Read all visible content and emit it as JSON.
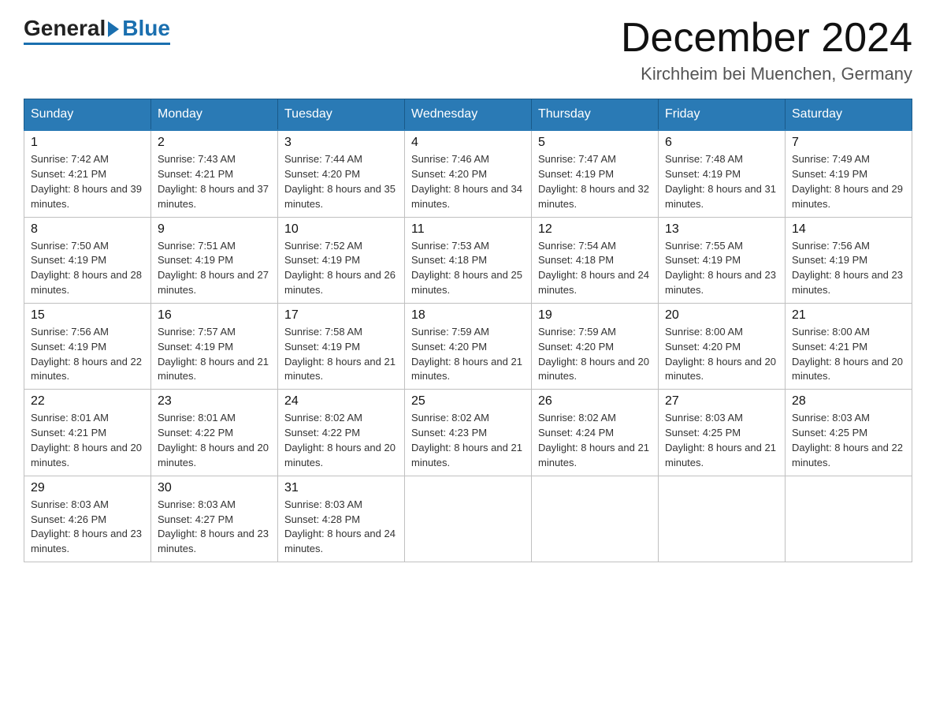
{
  "logo": {
    "general": "General",
    "blue": "Blue"
  },
  "header": {
    "month": "December 2024",
    "location": "Kirchheim bei Muenchen, Germany"
  },
  "days_of_week": [
    "Sunday",
    "Monday",
    "Tuesday",
    "Wednesday",
    "Thursday",
    "Friday",
    "Saturday"
  ],
  "weeks": [
    [
      {
        "day": "1",
        "sunrise": "7:42 AM",
        "sunset": "4:21 PM",
        "daylight": "8 hours and 39 minutes."
      },
      {
        "day": "2",
        "sunrise": "7:43 AM",
        "sunset": "4:21 PM",
        "daylight": "8 hours and 37 minutes."
      },
      {
        "day": "3",
        "sunrise": "7:44 AM",
        "sunset": "4:20 PM",
        "daylight": "8 hours and 35 minutes."
      },
      {
        "day": "4",
        "sunrise": "7:46 AM",
        "sunset": "4:20 PM",
        "daylight": "8 hours and 34 minutes."
      },
      {
        "day": "5",
        "sunrise": "7:47 AM",
        "sunset": "4:19 PM",
        "daylight": "8 hours and 32 minutes."
      },
      {
        "day": "6",
        "sunrise": "7:48 AM",
        "sunset": "4:19 PM",
        "daylight": "8 hours and 31 minutes."
      },
      {
        "day": "7",
        "sunrise": "7:49 AM",
        "sunset": "4:19 PM",
        "daylight": "8 hours and 29 minutes."
      }
    ],
    [
      {
        "day": "8",
        "sunrise": "7:50 AM",
        "sunset": "4:19 PM",
        "daylight": "8 hours and 28 minutes."
      },
      {
        "day": "9",
        "sunrise": "7:51 AM",
        "sunset": "4:19 PM",
        "daylight": "8 hours and 27 minutes."
      },
      {
        "day": "10",
        "sunrise": "7:52 AM",
        "sunset": "4:19 PM",
        "daylight": "8 hours and 26 minutes."
      },
      {
        "day": "11",
        "sunrise": "7:53 AM",
        "sunset": "4:18 PM",
        "daylight": "8 hours and 25 minutes."
      },
      {
        "day": "12",
        "sunrise": "7:54 AM",
        "sunset": "4:18 PM",
        "daylight": "8 hours and 24 minutes."
      },
      {
        "day": "13",
        "sunrise": "7:55 AM",
        "sunset": "4:19 PM",
        "daylight": "8 hours and 23 minutes."
      },
      {
        "day": "14",
        "sunrise": "7:56 AM",
        "sunset": "4:19 PM",
        "daylight": "8 hours and 23 minutes."
      }
    ],
    [
      {
        "day": "15",
        "sunrise": "7:56 AM",
        "sunset": "4:19 PM",
        "daylight": "8 hours and 22 minutes."
      },
      {
        "day": "16",
        "sunrise": "7:57 AM",
        "sunset": "4:19 PM",
        "daylight": "8 hours and 21 minutes."
      },
      {
        "day": "17",
        "sunrise": "7:58 AM",
        "sunset": "4:19 PM",
        "daylight": "8 hours and 21 minutes."
      },
      {
        "day": "18",
        "sunrise": "7:59 AM",
        "sunset": "4:20 PM",
        "daylight": "8 hours and 21 minutes."
      },
      {
        "day": "19",
        "sunrise": "7:59 AM",
        "sunset": "4:20 PM",
        "daylight": "8 hours and 20 minutes."
      },
      {
        "day": "20",
        "sunrise": "8:00 AM",
        "sunset": "4:20 PM",
        "daylight": "8 hours and 20 minutes."
      },
      {
        "day": "21",
        "sunrise": "8:00 AM",
        "sunset": "4:21 PM",
        "daylight": "8 hours and 20 minutes."
      }
    ],
    [
      {
        "day": "22",
        "sunrise": "8:01 AM",
        "sunset": "4:21 PM",
        "daylight": "8 hours and 20 minutes."
      },
      {
        "day": "23",
        "sunrise": "8:01 AM",
        "sunset": "4:22 PM",
        "daylight": "8 hours and 20 minutes."
      },
      {
        "day": "24",
        "sunrise": "8:02 AM",
        "sunset": "4:22 PM",
        "daylight": "8 hours and 20 minutes."
      },
      {
        "day": "25",
        "sunrise": "8:02 AM",
        "sunset": "4:23 PM",
        "daylight": "8 hours and 21 minutes."
      },
      {
        "day": "26",
        "sunrise": "8:02 AM",
        "sunset": "4:24 PM",
        "daylight": "8 hours and 21 minutes."
      },
      {
        "day": "27",
        "sunrise": "8:03 AM",
        "sunset": "4:25 PM",
        "daylight": "8 hours and 21 minutes."
      },
      {
        "day": "28",
        "sunrise": "8:03 AM",
        "sunset": "4:25 PM",
        "daylight": "8 hours and 22 minutes."
      }
    ],
    [
      {
        "day": "29",
        "sunrise": "8:03 AM",
        "sunset": "4:26 PM",
        "daylight": "8 hours and 23 minutes."
      },
      {
        "day": "30",
        "sunrise": "8:03 AM",
        "sunset": "4:27 PM",
        "daylight": "8 hours and 23 minutes."
      },
      {
        "day": "31",
        "sunrise": "8:03 AM",
        "sunset": "4:28 PM",
        "daylight": "8 hours and 24 minutes."
      },
      null,
      null,
      null,
      null
    ]
  ]
}
